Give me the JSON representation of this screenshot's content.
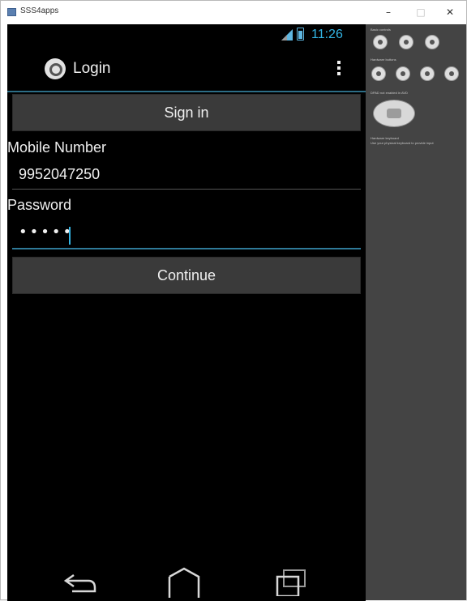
{
  "window": {
    "title": "SSS4apps",
    "controls": {
      "minimize": "–",
      "maximize": "□",
      "close": "✕"
    }
  },
  "status_bar": {
    "time": "11:26",
    "icons": [
      "signal-icon",
      "battery-icon"
    ]
  },
  "action_bar": {
    "title": "Login",
    "icons": [
      "app-logo-icon",
      "overflow-menu-icon"
    ]
  },
  "form": {
    "signin_button": "Sign in",
    "mobile_label": "Mobile Number",
    "mobile_value": "9952047250",
    "password_label": "Password",
    "password_value": "•••••",
    "continue_button": "Continue"
  },
  "nav_bar": {
    "icons": [
      "back-icon",
      "home-icon",
      "recents-icon"
    ]
  },
  "emulator_panel": {
    "labels": [
      "Basic controls",
      "Hardware buttons",
      "DPAD not enabled in AVD",
      "Hardware keyboard",
      "Use your physical keyboard to provide input"
    ]
  },
  "colors": {
    "accent": "#33b5e5",
    "screen_background": "#000000",
    "button_background": "#3a3a3a",
    "panel_background": "#444444"
  }
}
